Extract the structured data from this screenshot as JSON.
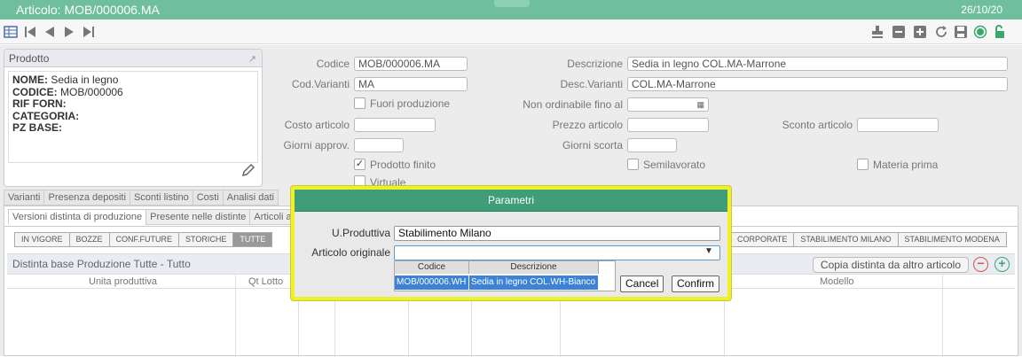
{
  "window": {
    "title": "Articolo: MOB/000006.MA",
    "date": "26/10/20"
  },
  "product_box": {
    "title": "Prodotto",
    "lines": [
      {
        "label": "NOME:",
        "value": "Sedia in legno"
      },
      {
        "label": "CODICE:",
        "value": "MOB/000006"
      },
      {
        "label": "RIF FORN:",
        "value": ""
      },
      {
        "label": "CATEGORIA:",
        "value": ""
      },
      {
        "label": "PZ BASE:",
        "value": ""
      }
    ]
  },
  "form": {
    "codice_label": "Codice",
    "codice": "MOB/000006.MA",
    "descrizione_label": "Descrizione",
    "descrizione": "Sedia in legno COL.MA-Marrone",
    "codvarianti_label": "Cod.Varianti",
    "codvarianti": "MA",
    "descvarianti_label": "Desc.Varianti",
    "descvarianti": "COL.MA-Marrone",
    "fuori_produzione": "Fuori produzione",
    "non_ordinabile": "Non ordinabile fino al",
    "costo": "Costo articolo",
    "prezzo": "Prezzo articolo",
    "sconto": "Sconto articolo",
    "giorni_approv": "Giorni approv.",
    "giorni_scorta": "Giorni scorta",
    "prodotto_finito": "Prodotto finito",
    "semilavorato": "Semilavorato",
    "materia_prima": "Materia prima",
    "virtuale": "Virtuale"
  },
  "tabs_top": [
    "Varianti",
    "Presenza depositi",
    "Sconti listino",
    "Costi",
    "Analisi dati"
  ],
  "tabs_sub": [
    "Versioni distinta di produzione",
    "Presente nelle distinte",
    "Articoli a"
  ],
  "filters_left": [
    "In vigore",
    "Bozze",
    "Conf.Future",
    "Storiche",
    "Tutte"
  ],
  "filters_right": [
    "Corporate",
    "Stabilimento Milano",
    "Stabilimento Modena"
  ],
  "grid": {
    "title": "Distinta base Produzione Tutte - Tutto",
    "copy_button": "Copia distinta da altro articolo",
    "col_unita": "Unita produttiva",
    "col_qt": "Qt Lotto",
    "col_modello": "Modello"
  },
  "dialog": {
    "title": "Parametri",
    "uprod_label": "U.Produttiva",
    "uprod_value": "Stabilimento Milano",
    "artorig_label": "Articolo originale",
    "artorig_value": "",
    "dropdown_headers": [
      "Codice",
      "Descrizione"
    ],
    "dropdown_row": {
      "codice": "MOB/000006.WH",
      "descrizione": "Sedia in legno COL.WH-Bianco"
    },
    "cancel": "Cancel",
    "confirm": "Confirm"
  },
  "colors": {
    "titlebar": "#6fbf9c",
    "dialog_header": "#3f9e77",
    "highlight": "#eef02a",
    "selection": "#3b82d8"
  }
}
